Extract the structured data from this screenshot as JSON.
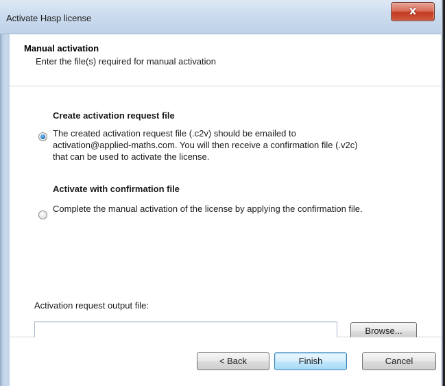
{
  "window": {
    "title": "Activate Hasp license",
    "close_glyph": "x"
  },
  "header": {
    "title": "Manual activation",
    "subtitle": "Enter the file(s) required for manual activation"
  },
  "options": {
    "create": {
      "title": "Create activation request file",
      "lines": [
        "The created activation request file (.c2v) should be emailed to",
        "activation@applied-maths.com. You will then receive a confirmation file (.v2c)",
        "that can be used to activate the license."
      ],
      "selected": true
    },
    "confirm": {
      "title": "Activate with confirmation file",
      "lines": [
        "Complete the manual activation of the license by applying the confirmation file."
      ],
      "selected": false
    }
  },
  "output_file": {
    "label": "Activation request output file:",
    "value": "",
    "browse_label": "Browse..."
  },
  "buttons": {
    "back": "< Back",
    "finish": "Finish",
    "cancel": "Cancel"
  }
}
